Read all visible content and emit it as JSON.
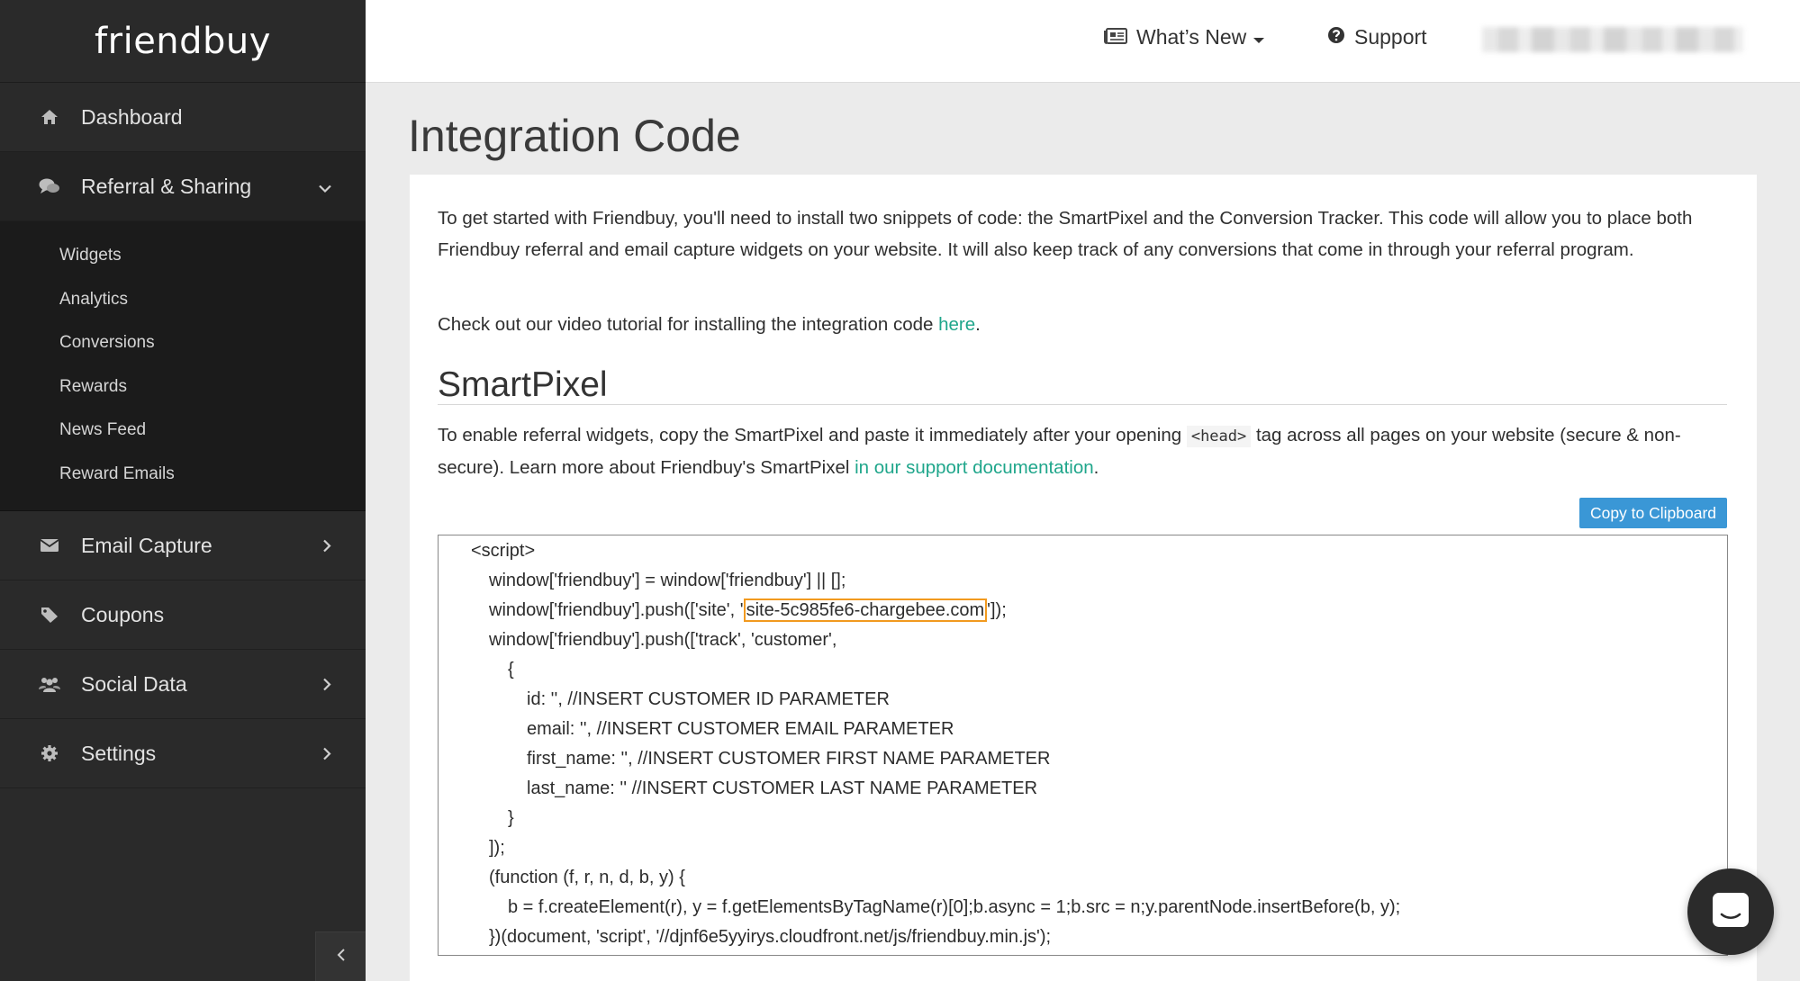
{
  "app": {
    "logo": "friendbuy"
  },
  "sidebar": {
    "items": [
      {
        "label": "Dashboard",
        "icon": "home-icon"
      },
      {
        "label": "Referral & Sharing",
        "icon": "comments-icon",
        "expanded": true
      },
      {
        "label": "Email Capture",
        "icon": "envelope-icon"
      },
      {
        "label": "Coupons",
        "icon": "tag-icon"
      },
      {
        "label": "Social Data",
        "icon": "users-icon"
      },
      {
        "label": "Settings",
        "icon": "gear-icon"
      }
    ],
    "subitems": [
      "Widgets",
      "Analytics",
      "Conversions",
      "Rewards",
      "News Feed",
      "Reward Emails"
    ]
  },
  "topbar": {
    "whats_new": "What’s New",
    "support": "Support"
  },
  "page": {
    "title": "Integration Code",
    "intro": "To get started with Friendbuy, you'll need to install two snippets of code: the SmartPixel and the Conversion Tracker. This code will allow you to place both Friendbuy referral and email capture widgets on your website. It will also keep track of any conversions that come in through your referral program.",
    "video_prefix": "Check out our video tutorial for installing the integration code ",
    "video_link": "here",
    "video_suffix": ".",
    "smartpixel_heading": "SmartPixel",
    "smartpixel_text_1": "To enable referral widgets, copy the SmartPixel and paste it immediately after your opening ",
    "smartpixel_code_tag": "<head>",
    "smartpixel_text_2": " tag across all pages on your website (secure & non-secure). Learn more about Friendbuy's SmartPixel ",
    "smartpixel_link": "in our support documentation",
    "smartpixel_text_3": ".",
    "copy_button": "Copy to Clipboard"
  },
  "code": {
    "lines": [
      "<script>",
      "window['friendbuy'] = window['friendbuy'] || [];",
      "window['friendbuy'].push(['site', '",
      "window['friendbuy'].push(['track', 'customer',",
      "{",
      "id: '', //INSERT CUSTOMER ID PARAMETER",
      "email: '', //INSERT CUSTOMER EMAIL PARAMETER",
      "first_name: '', //INSERT CUSTOMER FIRST NAME PARAMETER",
      "last_name: '' //INSERT CUSTOMER LAST NAME PARAMETER",
      "}",
      "]);",
      "(function (f, r, n, d, b, y) {",
      "b = f.createElement(r), y = f.getElementsByTagName(r)[0];b.async = 1;b.src = n;y.parentNode.insertBefore(b, y);",
      "})(document, 'script', '//djnf6e5yyirys.cloudfront.net/js/friendbuy.min.js');"
    ],
    "site_id": "site-5c985fe6-chargebee.com",
    "site_suffix": "']);"
  },
  "colors": {
    "accent_link": "#1fa68b",
    "button_blue": "#3a97d6",
    "highlight_orange": "#f29a1f",
    "sidebar_bg": "#2a2a2a"
  }
}
